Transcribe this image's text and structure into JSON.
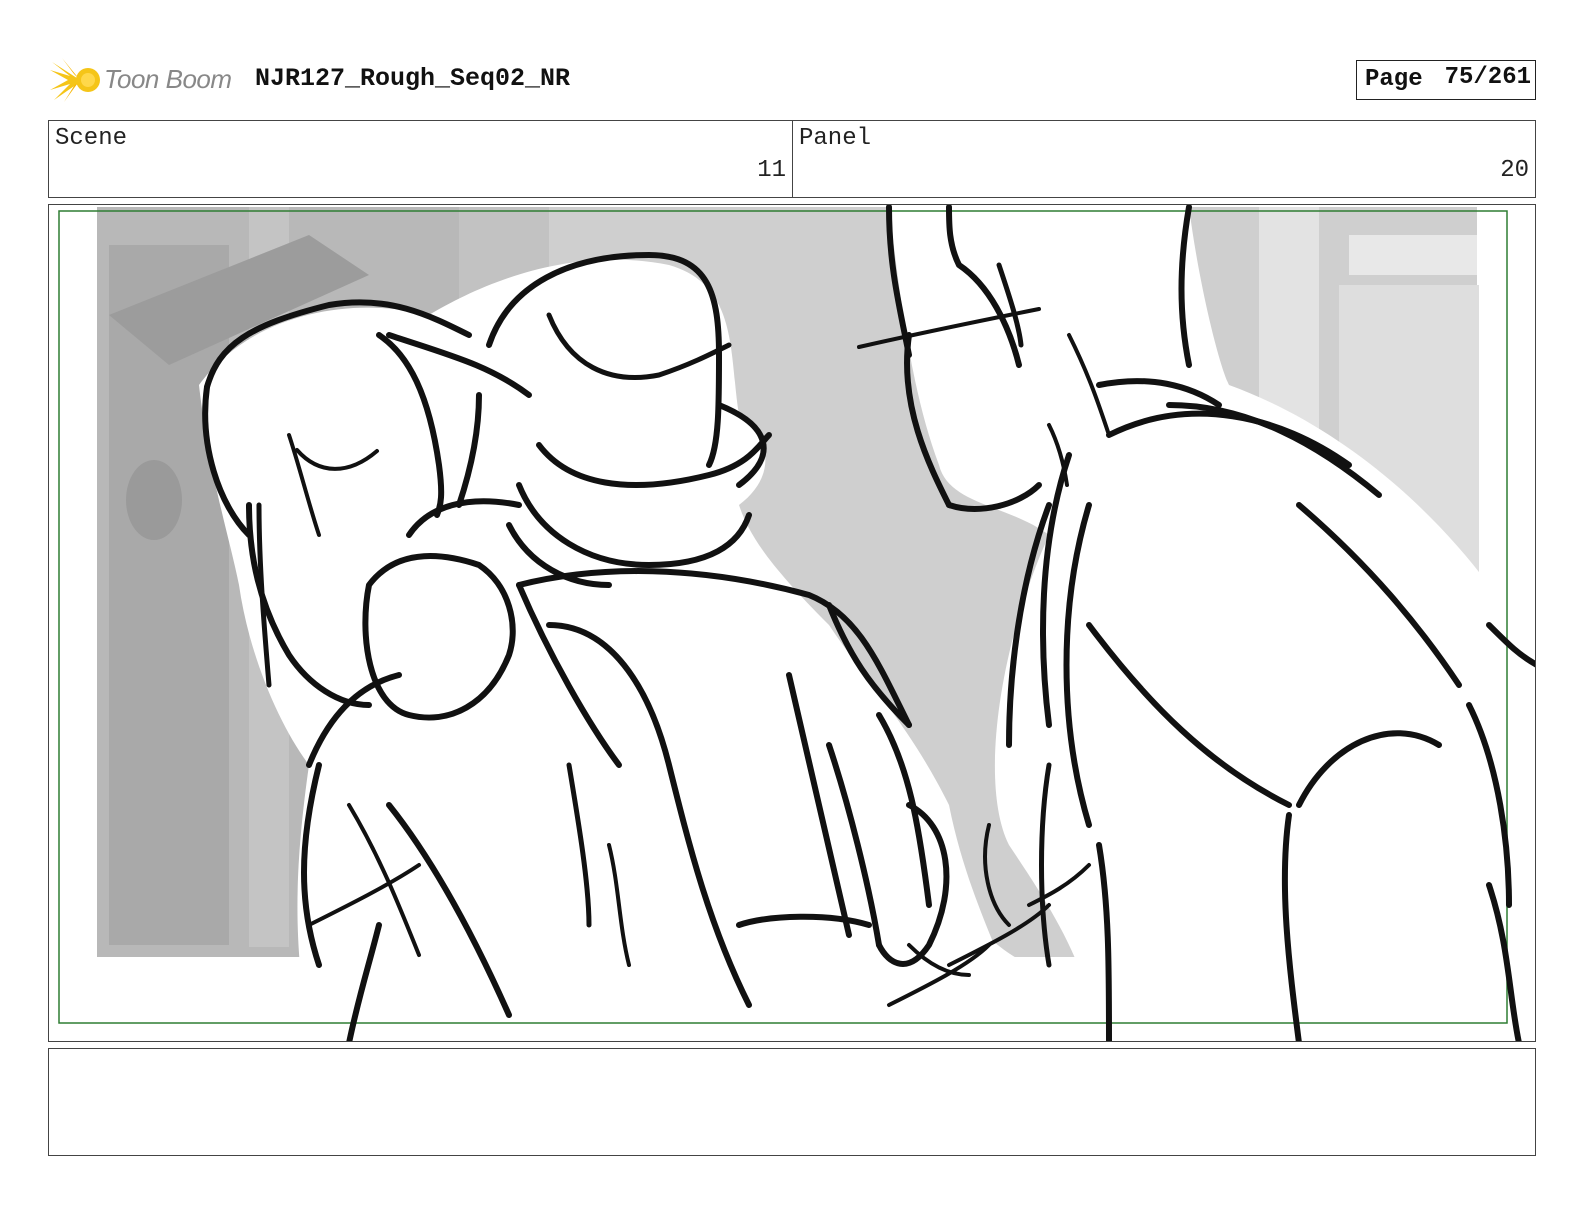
{
  "header": {
    "logo_text": "Toon Boom",
    "logo_icon": "toon-boom-burst-icon",
    "project_title": "NJR127_Rough_Seq02_NR",
    "page_label": "Page",
    "page_number": "75/261"
  },
  "info": {
    "scene_label": "Scene",
    "scene_value": "11",
    "panel_label": "Panel",
    "panel_value": "20"
  },
  "storyboard_panel": {
    "content": "rough storyboard sketch"
  },
  "notes": {
    "text": ""
  },
  "colors": {
    "safe_frame": "#2e7d32",
    "logo_yellow": "#f5c518",
    "background_gray": "#d0d0d0"
  }
}
